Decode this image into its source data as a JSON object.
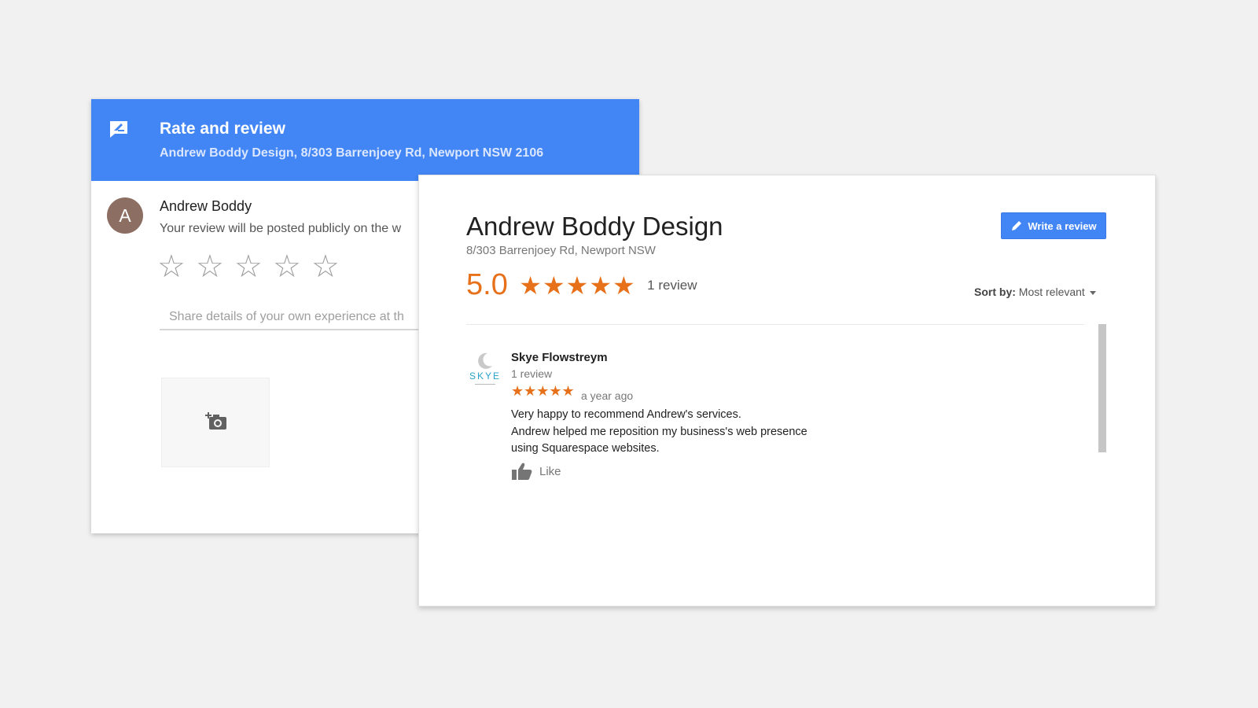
{
  "rate_dialog": {
    "title": "Rate and review",
    "subtitle": "Andrew Boddy Design, 8/303 Barrenjoey Rd, Newport NSW 2106",
    "user": {
      "avatar_letter": "A",
      "name": "Andrew Boddy",
      "note": "Your review will be posted publicly on the w"
    },
    "stars": [
      "☆",
      "☆",
      "☆",
      "☆",
      "☆"
    ],
    "placeholder": "Share details of your own experience at th",
    "header_color": "#4285f4",
    "avatar_color": "#8d6e63"
  },
  "business": {
    "name": "Andrew Boddy Design",
    "address": "8/303 Barrenjoey Rd, Newport NSW",
    "write_review_label": "Write a review",
    "rating": "5.0",
    "rating_stars": "★★★★★",
    "review_count": "1 review",
    "sort_label": "Sort by:",
    "sort_value": "Most relevant",
    "accent_color": "#e7711b"
  },
  "reviews": [
    {
      "author": "Skye Flowstreym",
      "author_reviews": "1 review",
      "stars": "★★★★★",
      "time": "a year ago",
      "lines": [
        "Very happy to recommend Andrew's services.",
        "Andrew helped me reposition my business's web presence",
        "using Squarespace websites."
      ],
      "like_label": "Like",
      "logo_text": "SKYE"
    }
  ]
}
